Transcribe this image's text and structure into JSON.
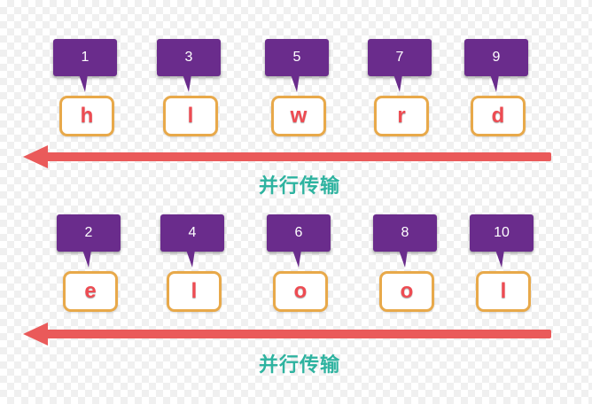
{
  "rows": [
    {
      "items": [
        {
          "number": "1",
          "char": "h"
        },
        {
          "number": "3",
          "char": "l"
        },
        {
          "number": "5",
          "char": "w"
        },
        {
          "number": "7",
          "char": "r"
        },
        {
          "number": "9",
          "char": "d"
        }
      ],
      "caption": "并行传输"
    },
    {
      "items": [
        {
          "number": "2",
          "char": "e"
        },
        {
          "number": "4",
          "char": "l"
        },
        {
          "number": "6",
          "char": "o"
        },
        {
          "number": "8",
          "char": "o"
        },
        {
          "number": "10",
          "char": "l"
        }
      ],
      "caption": "并行传输"
    }
  ],
  "colors": {
    "bubble": "#6a2c8c",
    "char_border": "#e8a94a",
    "char_text": "#ee4b52",
    "arrow": "#ea5a5a",
    "caption": "#2eb3a0"
  }
}
